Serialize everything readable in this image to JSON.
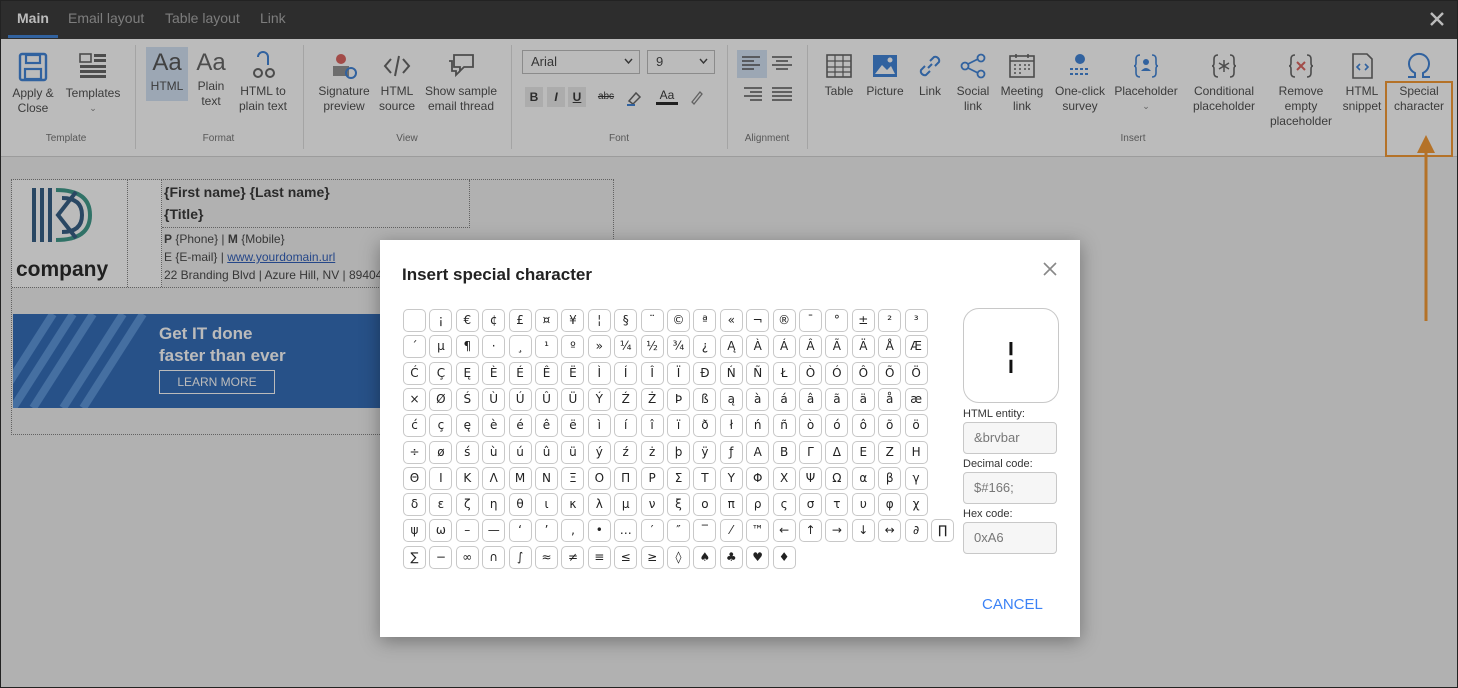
{
  "tabs": [
    {
      "label": "Main"
    },
    {
      "label": "Email layout"
    },
    {
      "label": "Table layout"
    },
    {
      "label": "Link"
    }
  ],
  "ribbon": {
    "template": {
      "apply_close": "Apply &\nClose",
      "templates": "Templates",
      "group": "Template"
    },
    "format": {
      "html": "HTML",
      "plain_text": "Plain\ntext",
      "html_to_plain": "HTML to\nplain text",
      "group": "Format"
    },
    "view": {
      "signature_preview": "Signature\npreview",
      "html_source": "HTML\nsource",
      "sample_thread": "Show sample\nemail thread",
      "group": "View"
    },
    "font": {
      "family": "Arial",
      "size": "9",
      "bold": "B",
      "italic": "I",
      "underline": "U",
      "strike": "abc",
      "color": "Aa",
      "group": "Font"
    },
    "alignment": {
      "group": "Alignment"
    },
    "insert": {
      "table": "Table",
      "picture": "Picture",
      "link": "Link",
      "social_link": "Social\nlink",
      "meeting_link": "Meeting\nlink",
      "survey": "One-click\nsurvey",
      "placeholder": "Placeholder",
      "conditional": "Conditional\nplaceholder",
      "remove_empty": "Remove\nempty\nplaceholder",
      "html_snippet": "HTML\nsnippet",
      "special_char": "Special\ncharacter",
      "group": "Insert"
    }
  },
  "signature": {
    "name": "{First name} {Last name}",
    "title": "{Title}",
    "phone_label": "P",
    "phone": "{Phone}",
    "sep": "|",
    "mobile_label": "M",
    "mobile": "{Mobile}",
    "email_label": "E",
    "email": "{E-mail}",
    "website": "www.yourdomain.url",
    "address": "22 Branding Blvd | Azure Hill, NV | 89404",
    "company": "company",
    "banner_line1": "Get IT done",
    "banner_line2": "faster than ever",
    "banner_button": "LEARN MORE"
  },
  "dialog": {
    "title": "Insert special character",
    "characters": [
      " ",
      "¡",
      "€",
      "¢",
      "£",
      "¤",
      "¥",
      "¦",
      "§",
      "¨",
      "©",
      "ª",
      "«",
      "¬",
      "®",
      "¯",
      "°",
      "±",
      "²",
      "³",
      "´",
      "µ",
      "¶",
      "·",
      "¸",
      "¹",
      "º",
      "»",
      "¼",
      "½",
      "¾",
      "¿",
      "Ą",
      "À",
      "Á",
      "Â",
      "Ã",
      "Ä",
      "Å",
      "Æ",
      "Ć",
      "Ç",
      "Ę",
      "È",
      "É",
      "Ê",
      "Ë",
      "Ì",
      "Í",
      "Î",
      "Ï",
      "Đ",
      "Ń",
      "Ñ",
      "Ł",
      "Ò",
      "Ó",
      "Ô",
      "Õ",
      "Ö",
      "×",
      "Ø",
      "Ś",
      "Ù",
      "Ú",
      "Û",
      "Ü",
      "Ý",
      "Ź",
      "Ż",
      "Þ",
      "ß",
      "ą",
      "à",
      "á",
      "â",
      "ã",
      "ä",
      "å",
      "æ",
      "ć",
      "ç",
      "ę",
      "è",
      "é",
      "ê",
      "ë",
      "ì",
      "í",
      "î",
      "ï",
      "ð",
      "ł",
      "ń",
      "ñ",
      "ò",
      "ó",
      "ô",
      "õ",
      "ö",
      "÷",
      "ø",
      "ś",
      "ù",
      "ú",
      "û",
      "ü",
      "ý",
      "ź",
      "ż",
      "þ",
      "ÿ",
      "ƒ",
      "Α",
      "Β",
      "Γ",
      "Δ",
      "Ε",
      "Ζ",
      "Η",
      "Θ",
      "Ι",
      "Κ",
      "Λ",
      "Μ",
      "Ν",
      "Ξ",
      "Ο",
      "Π",
      "Ρ",
      "Σ",
      "Τ",
      "Υ",
      "Φ",
      "Χ",
      "Ψ",
      "Ω",
      "α",
      "β",
      "γ",
      "δ",
      "ε",
      "ζ",
      "η",
      "θ",
      "ι",
      "κ",
      "λ",
      "μ",
      "ν",
      "ξ",
      "ο",
      "π",
      "ρ",
      "ς",
      "σ",
      "τ",
      "υ",
      "φ",
      "χ",
      "ψ",
      "ω",
      "–",
      "—",
      "‘",
      "’",
      "‚",
      "•",
      "…",
      "′",
      "″",
      "‾",
      "⁄",
      "™",
      "←",
      "↑",
      "→",
      "↓",
      "↔",
      "∂",
      "∏",
      "∑",
      "−",
      "∞",
      "∩",
      "∫",
      "≈",
      "≠",
      "≡",
      "≤",
      "≥",
      "◊",
      "♠",
      "♣",
      "♥",
      "♦"
    ],
    "preview": "¦",
    "html_entity_label": "HTML entity:",
    "html_entity": "&brvbar",
    "decimal_label": "Decimal code:",
    "decimal": "$#166;",
    "hex_label": "Hex code:",
    "hex": "0xA6",
    "cancel": "CANCEL"
  },
  "colors": {
    "accent": "#2b77d4",
    "callout": "#f5901e",
    "titlebar": "#262626",
    "banner": "#1d5db1"
  }
}
